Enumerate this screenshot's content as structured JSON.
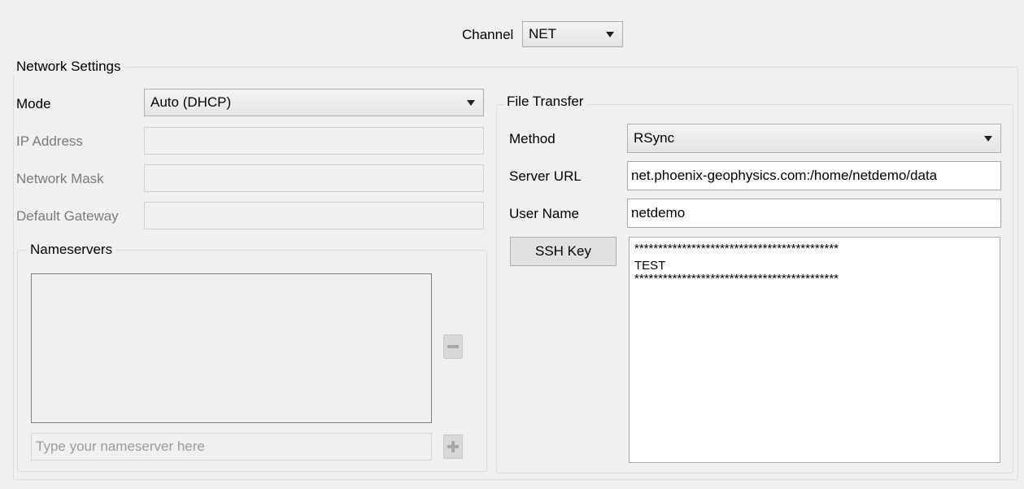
{
  "channel": {
    "label": "Channel",
    "value": "NET"
  },
  "network_settings": {
    "title": "Network Settings",
    "mode": {
      "label": "Mode",
      "value": "Auto (DHCP)"
    },
    "ip_address": {
      "label": "IP Address",
      "value": ""
    },
    "network_mask": {
      "label": "Network Mask",
      "value": ""
    },
    "default_gateway": {
      "label": "Default Gateway",
      "value": ""
    },
    "nameservers": {
      "title": "Nameservers",
      "items": [],
      "input_placeholder": "Type your nameserver here",
      "remove_icon": "minus-icon",
      "add_icon": "plus-icon"
    }
  },
  "file_transfer": {
    "title": "File Transfer",
    "method": {
      "label": "Method",
      "value": "RSync"
    },
    "server_url": {
      "label": "Server URL",
      "value": "net.phoenix-geophysics.com:/home/netdemo/data"
    },
    "user_name": {
      "label": "User Name",
      "value": "netdemo"
    },
    "ssh_key": {
      "button_label": "SSH Key",
      "line1": "*******************************************",
      "line2": "TEST",
      "line3": "*******************************************"
    }
  }
}
